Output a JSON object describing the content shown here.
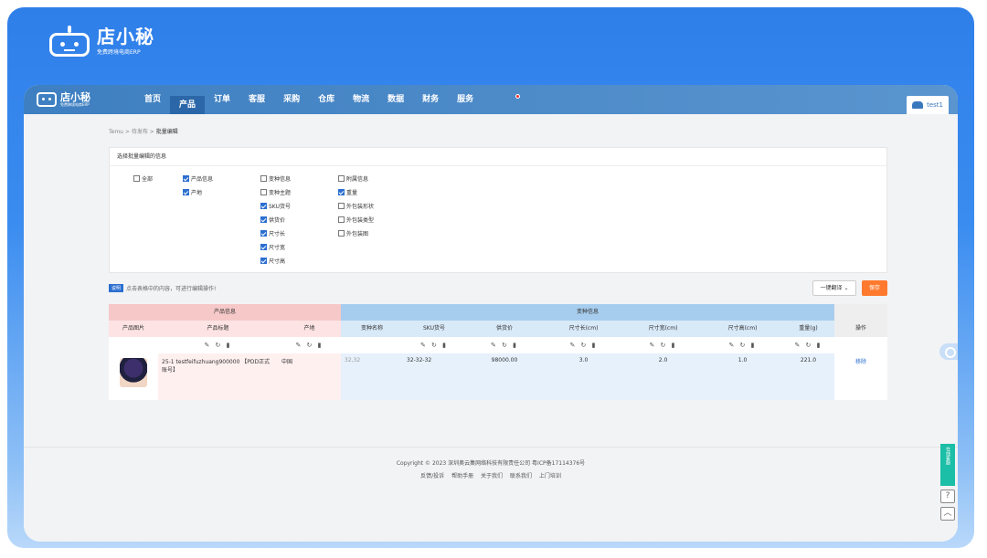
{
  "brand": {
    "name": "店小秘",
    "subtitle": "免费跨境电商ERP",
    "nav_sub": "免费跨境电商ERP"
  },
  "nav": {
    "items": [
      "首页",
      "产品",
      "订单",
      "客服",
      "采购",
      "仓库",
      "物流",
      "数据",
      "财务",
      "服务"
    ],
    "active": "产品",
    "user": "test1"
  },
  "breadcrumb": {
    "items": [
      "Temu",
      "待发布",
      "批量编辑"
    ],
    "sep": ">"
  },
  "panel": {
    "title": "选择批量编辑的信息",
    "all": {
      "label": "全部",
      "checked": false
    },
    "col1": [
      {
        "label": "产品信息",
        "checked": true
      },
      {
        "label": "产地",
        "checked": true
      }
    ],
    "col2": [
      {
        "label": "变种信息",
        "checked": false
      },
      {
        "label": "变种主题",
        "checked": false
      },
      {
        "label": "SKU货号",
        "checked": true
      },
      {
        "label": "供货价",
        "checked": true
      },
      {
        "label": "尺寸长",
        "checked": true
      },
      {
        "label": "尺寸宽",
        "checked": true
      },
      {
        "label": "尺寸高",
        "checked": true
      }
    ],
    "col3": [
      {
        "label": "附属信息",
        "checked": false
      },
      {
        "label": "重量",
        "checked": true
      },
      {
        "label": "外包装形状",
        "checked": false
      },
      {
        "label": "外包装类型",
        "checked": false
      },
      {
        "label": "外包装图",
        "checked": false
      }
    ]
  },
  "hint": {
    "tag": "说明",
    "text": "点击表格中的内容，可进行编辑操作!"
  },
  "actions": {
    "translate": "一键翻译 ⌄",
    "save": "保存"
  },
  "table": {
    "group_product": "产品信息",
    "group_variant": "变种信息",
    "headers": [
      "产品图片",
      "产品标题",
      "产地",
      "变种名称",
      "SKU货号",
      "供货价",
      "尺寸长(cm)",
      "尺寸宽(cm)",
      "尺寸高(cm)",
      "重量(g)",
      "操作"
    ],
    "op_icons": "✎ ↻ ▮",
    "row": {
      "title": "25-1 testfeifuzhuang900000 【PDD正式账号】",
      "origin": "中国",
      "variant": "32,32",
      "sku": "32-32-32",
      "price": "98000.00",
      "length": "3.0",
      "width": "2.0",
      "height": "1.0",
      "weight": "221.0",
      "remove": "移除"
    }
  },
  "footer": {
    "copyright": "Copyright © 2023 深圳奥云集网络科技有限责任公司  粤ICP备17114376号",
    "links": [
      "反馈/投诉",
      "帮助手册",
      "关于我们",
      "联系我们",
      "上门培训"
    ]
  },
  "float": {
    "label": "在线客服",
    "help": "?",
    "top": "︿"
  },
  "colors": {
    "nav": "#3e7fc1",
    "save": "#ff7a2e",
    "accent": "#2c6fd0"
  }
}
